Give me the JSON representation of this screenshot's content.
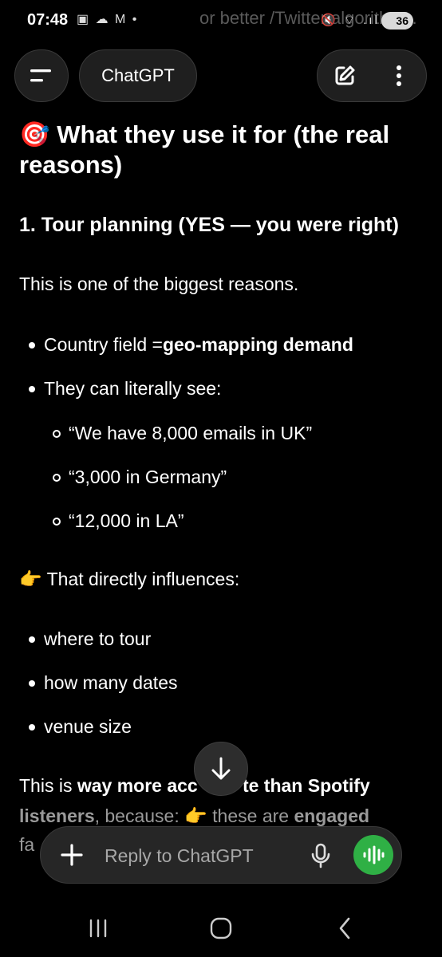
{
  "status_bar": {
    "time": "07:48",
    "left_icons": "▣ ☁ M •",
    "right_icons": "🔇 ⌔ .ıl",
    "battery": "36",
    "background_text": "or better /Twitter algorithms."
  },
  "header": {
    "title": "ChatGPT"
  },
  "content": {
    "heading_emoji": "🎯",
    "heading": " What they use it for (the real reasons)",
    "section_title": "1. Tour planning (YES — you were right)",
    "intro": "This is one of the biggest reasons.",
    "bullets": [
      {
        "plain": "Country field = ",
        "bold": "geo-mapping demand"
      },
      {
        "plain": "They can literally see:"
      }
    ],
    "sub_bullets": [
      "“We have 8,000 emails in UK”",
      "“3,000 in Germany”",
      "“12,000 in LA”"
    ],
    "pointer_emoji": "👉",
    "influence_line": " That directly influences:",
    "influence_bullets": [
      "where to tour",
      "how many dates",
      "venue size"
    ],
    "closing": {
      "start": "This is ",
      "bold1": "way more acc",
      "hidden_bold": "urate",
      "bold2": "te than Spotify",
      "bold3": "listeners",
      "mid": ", because: ",
      "pointer": "👉",
      "after_pointer": " these are ",
      "bold4": "engaged",
      "line3": "fa"
    }
  },
  "composer": {
    "placeholder": "Reply to ChatGPT"
  },
  "colors": {
    "background": "#000000",
    "pill": "#1f1f1f",
    "voice": "#2fb045"
  }
}
